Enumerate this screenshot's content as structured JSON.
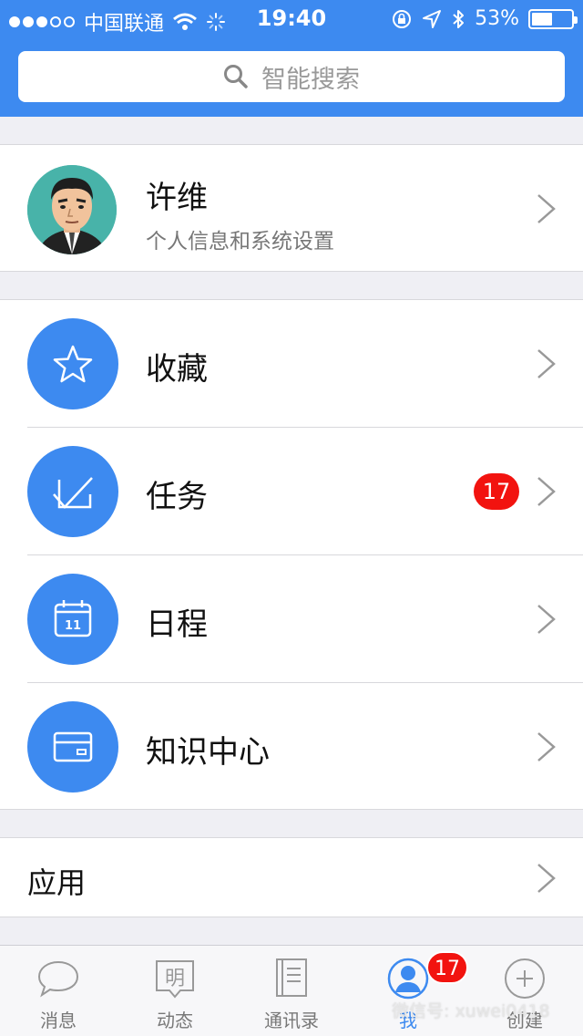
{
  "status_bar": {
    "carrier": "中国联通",
    "time": "19:40",
    "battery": "53%",
    "battery_level": 0.53
  },
  "search": {
    "placeholder": "智能搜索"
  },
  "profile": {
    "name": "许维",
    "subtitle": "个人信息和系统设置"
  },
  "menu": [
    {
      "label": "收藏",
      "icon": "star-icon"
    },
    {
      "label": "任务",
      "icon": "task-check-icon",
      "badge": "17"
    },
    {
      "label": "日程",
      "icon": "calendar-icon",
      "icon_text": "11"
    },
    {
      "label": "知识中心",
      "icon": "card-icon"
    }
  ],
  "apps": {
    "label": "应用"
  },
  "tabbar": {
    "tabs": [
      {
        "label": "消息",
        "icon": "chat-bubble-icon"
      },
      {
        "label": "动态",
        "icon": "feed-icon",
        "icon_text": "明"
      },
      {
        "label": "通讯录",
        "icon": "contacts-book-icon"
      },
      {
        "label": "我",
        "icon": "person-icon",
        "badge": "17",
        "active": true
      },
      {
        "label": "创建",
        "icon": "plus-circle-icon"
      }
    ]
  },
  "watermark": "微信号: xuwei0418",
  "colors": {
    "accent": "#3d8af0",
    "badge": "#f2130f"
  }
}
